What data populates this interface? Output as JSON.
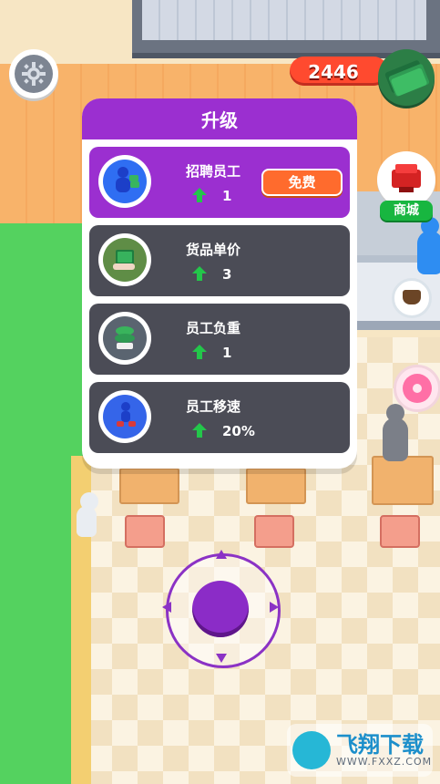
{
  "hud": {
    "settings_icon": "gear-icon",
    "currency_amount": "2446",
    "currency_icon": "cash-stack-icon"
  },
  "shop": {
    "label": "商城",
    "icon": "cash-register-icon"
  },
  "upgrade_panel": {
    "title": "升级",
    "items": [
      {
        "label": "招聘员工",
        "value": "1",
        "button_label": "免费",
        "icon": "hire-staff-icon",
        "accent": "#9b2fd0"
      },
      {
        "label": "货品单价",
        "value": "3",
        "icon": "cash-hand-icon",
        "accent": "#4b4c56"
      },
      {
        "label": "员工负重",
        "value": "1",
        "icon": "stacked-items-icon",
        "accent": "#4b4c56"
      },
      {
        "label": "员工移速",
        "value": "20%",
        "icon": "running-staff-icon",
        "accent": "#4b4c56"
      }
    ]
  },
  "joystick": {
    "icon": "joystick-icon",
    "accent": "#8b2cc7"
  },
  "watermark": {
    "title": "飞翔下载",
    "url": "WWW.FXXZ.COM"
  }
}
